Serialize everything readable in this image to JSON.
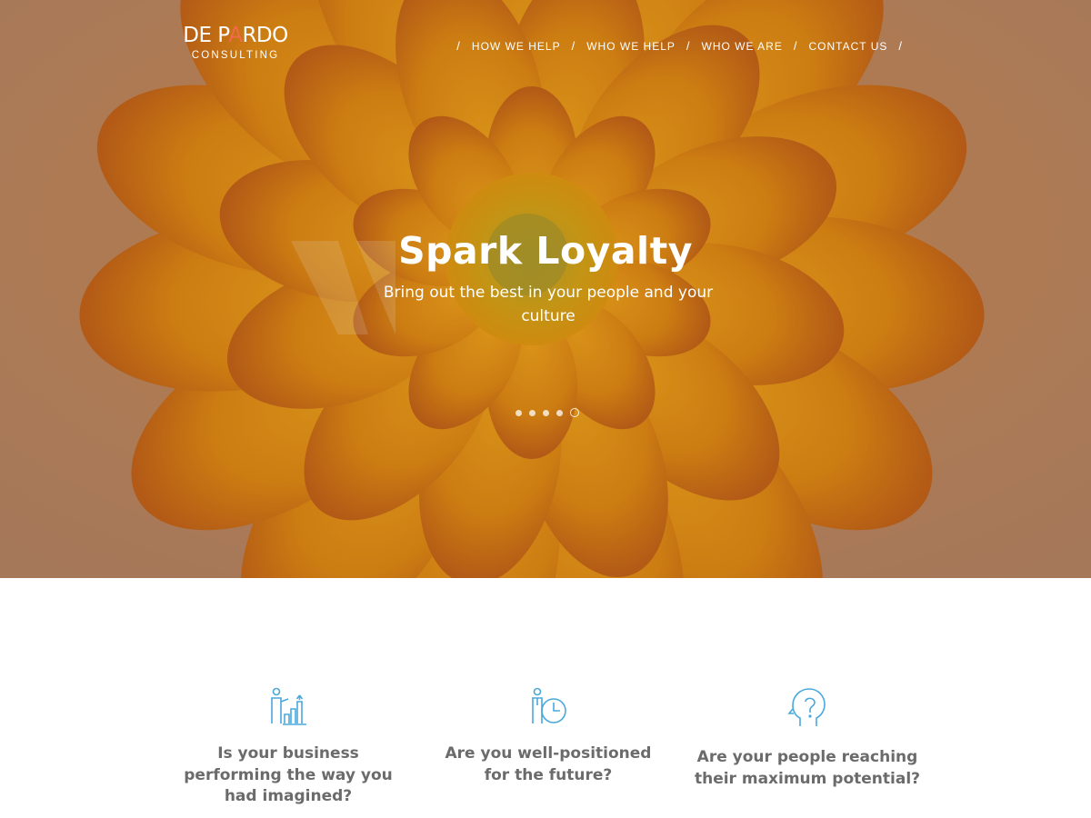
{
  "brand": {
    "name_part1": "DE P",
    "name_accent": "A",
    "name_part2": "RDO",
    "tagline": "CONSULTING",
    "accent_color": "#f26a4b"
  },
  "nav": {
    "separator": "/",
    "items": [
      {
        "label": "HOW WE HELP"
      },
      {
        "label": "WHO WE HELP"
      },
      {
        "label": "WHO WE ARE"
      },
      {
        "label": "CONTACT US"
      }
    ]
  },
  "hero": {
    "title": "Spark Loyalty",
    "subtitle": "Bring out the best in your people and your culture",
    "slide_count": 5,
    "active_slide": 5
  },
  "features": [
    {
      "icon": "business-growth-icon",
      "title": "Is your business performing the way you had imagined?"
    },
    {
      "icon": "person-clock-icon",
      "title": "Are you well-positioned for the future?"
    },
    {
      "icon": "head-question-icon",
      "title": "Are your people reaching their maximum potential?"
    }
  ],
  "colors": {
    "icon_blue": "#4aa8dc",
    "feature_text": "#6b6b6b"
  }
}
